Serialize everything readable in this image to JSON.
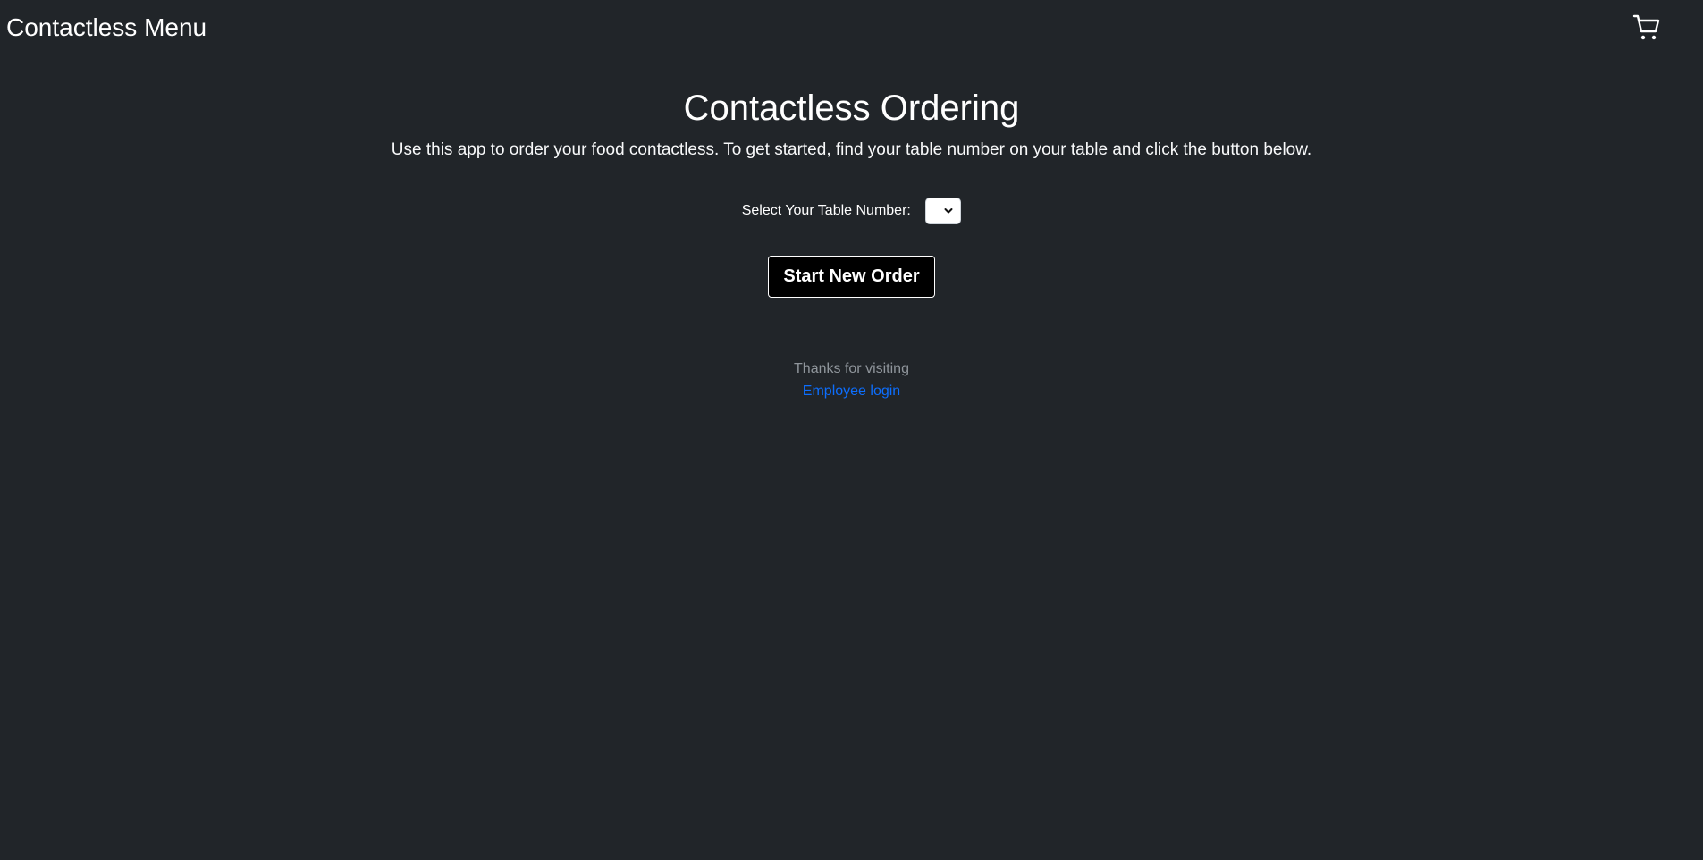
{
  "navbar": {
    "brand": "Contactless Menu",
    "cart_icon": "shopping-cart-icon"
  },
  "hero": {
    "title": "Contactless Ordering",
    "description": "Use this app to order your food contactless. To get started, find your table number on your table and click the button below."
  },
  "table_selector": {
    "label": "Select Your Table Number:",
    "selected_value": "",
    "icon": "chevron-down-icon"
  },
  "start_button": {
    "label": "Start New Order"
  },
  "footer": {
    "thanks": "Thanks for visiting",
    "login_link": "Employee login"
  },
  "colors": {
    "background": "#212529",
    "text": "#ffffff",
    "muted": "#8f959b",
    "link": "#0d6efd",
    "button_bg": "#000000"
  }
}
